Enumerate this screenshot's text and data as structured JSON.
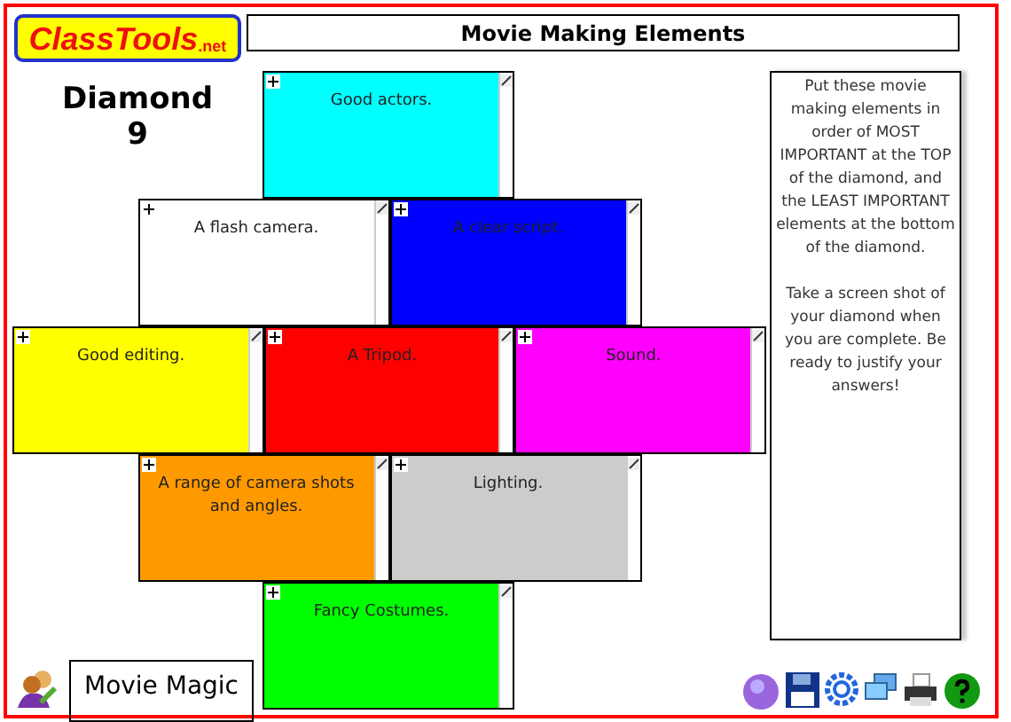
{
  "logo": {
    "text": "ClassTools",
    "suffix": ".net"
  },
  "title": "Movie Making Elements",
  "heading": [
    "Diamond",
    "9"
  ],
  "rows": [
    [
      {
        "text": "Good actors.",
        "color": "#00ffff"
      }
    ],
    [
      {
        "text": "A flash camera.",
        "color": "#ffffff"
      },
      {
        "text": "A clear script.",
        "color": "#0000ff"
      }
    ],
    [
      {
        "text": "Good editing.",
        "color": "#ffff00"
      },
      {
        "text": "A Tripod.",
        "color": "#ff0000"
      },
      {
        "text": "Sound.",
        "color": "#ff00ff"
      }
    ],
    [
      {
        "text": "A range of camera shots and angles.",
        "color": "#ff9900"
      },
      {
        "text": "Lighting.",
        "color": "#cccccc"
      }
    ],
    [
      {
        "text": "Fancy Costumes.",
        "color": "#00ff00"
      }
    ]
  ],
  "instructions": [
    "Put these movie making elements in order of MOST IMPORTANT at the TOP of the diamond, and the LEAST IMPORTANT elements at the bottom of the diamond.",
    "Take a screen shot of your diamond when you are complete.  Be ready to justify your answers!"
  ],
  "name": "Movie Magic"
}
